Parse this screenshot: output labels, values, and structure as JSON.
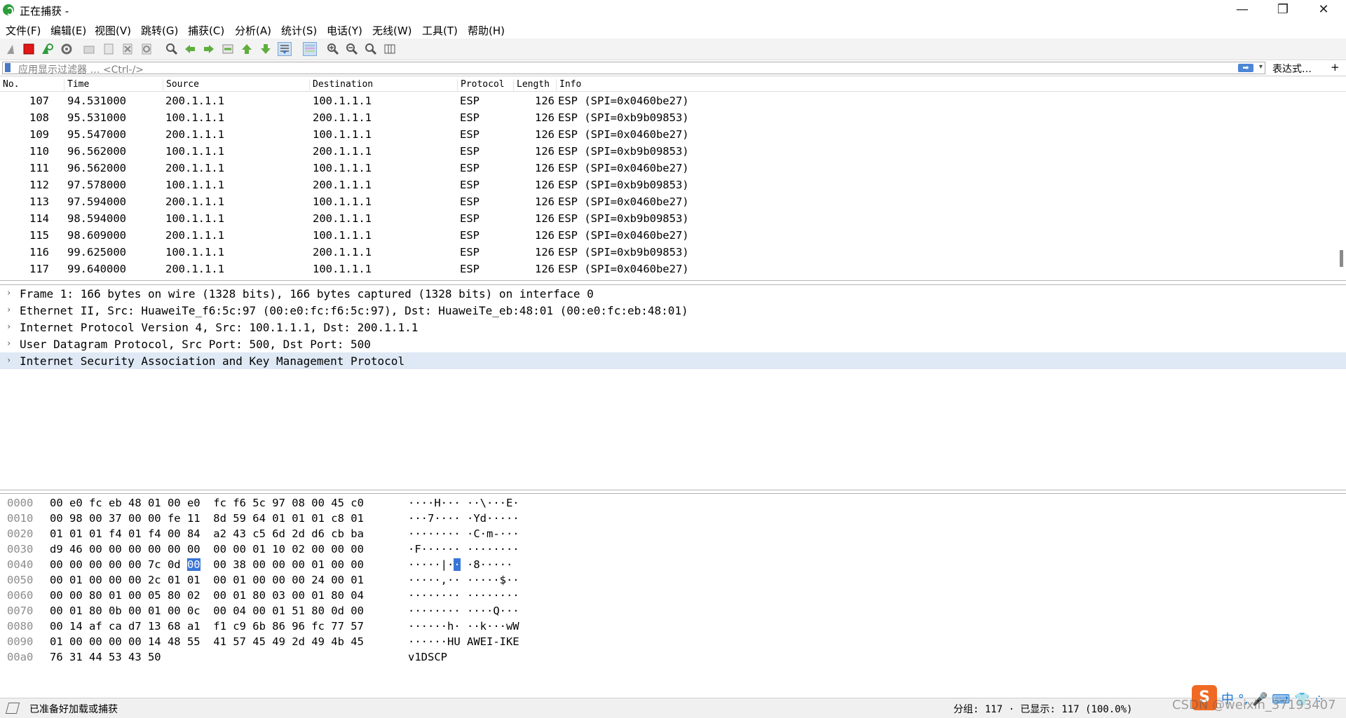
{
  "window": {
    "title": "正在捕获 -",
    "controls": [
      "—",
      "❐",
      "✕"
    ]
  },
  "menu": [
    "文件(F)",
    "编辑(E)",
    "视图(V)",
    "跳转(G)",
    "捕获(C)",
    "分析(A)",
    "统计(S)",
    "电话(Y)",
    "无线(W)",
    "工具(T)",
    "帮助(H)"
  ],
  "filter": {
    "placeholder": "应用显示过滤器 … <Ctrl-/>",
    "apply_label": "➡",
    "dropdown": "▾",
    "expression_label": "表达式…",
    "add_label": "+"
  },
  "packet_list": {
    "columns": [
      "No.",
      "Time",
      "Source",
      "Destination",
      "Protocol",
      "Length",
      "Info"
    ],
    "rows": [
      {
        "no": "107",
        "time": "94.531000",
        "src": "200.1.1.1",
        "dst": "100.1.1.1",
        "proto": "ESP",
        "len": "126",
        "info": "ESP (SPI=0x0460be27)"
      },
      {
        "no": "108",
        "time": "95.531000",
        "src": "100.1.1.1",
        "dst": "200.1.1.1",
        "proto": "ESP",
        "len": "126",
        "info": "ESP (SPI=0xb9b09853)"
      },
      {
        "no": "109",
        "time": "95.547000",
        "src": "200.1.1.1",
        "dst": "100.1.1.1",
        "proto": "ESP",
        "len": "126",
        "info": "ESP (SPI=0x0460be27)"
      },
      {
        "no": "110",
        "time": "96.562000",
        "src": "100.1.1.1",
        "dst": "200.1.1.1",
        "proto": "ESP",
        "len": "126",
        "info": "ESP (SPI=0xb9b09853)"
      },
      {
        "no": "111",
        "time": "96.562000",
        "src": "200.1.1.1",
        "dst": "100.1.1.1",
        "proto": "ESP",
        "len": "126",
        "info": "ESP (SPI=0x0460be27)"
      },
      {
        "no": "112",
        "time": "97.578000",
        "src": "100.1.1.1",
        "dst": "200.1.1.1",
        "proto": "ESP",
        "len": "126",
        "info": "ESP (SPI=0xb9b09853)"
      },
      {
        "no": "113",
        "time": "97.594000",
        "src": "200.1.1.1",
        "dst": "100.1.1.1",
        "proto": "ESP",
        "len": "126",
        "info": "ESP (SPI=0x0460be27)"
      },
      {
        "no": "114",
        "time": "98.594000",
        "src": "100.1.1.1",
        "dst": "200.1.1.1",
        "proto": "ESP",
        "len": "126",
        "info": "ESP (SPI=0xb9b09853)"
      },
      {
        "no": "115",
        "time": "98.609000",
        "src": "200.1.1.1",
        "dst": "100.1.1.1",
        "proto": "ESP",
        "len": "126",
        "info": "ESP (SPI=0x0460be27)"
      },
      {
        "no": "116",
        "time": "99.625000",
        "src": "100.1.1.1",
        "dst": "200.1.1.1",
        "proto": "ESP",
        "len": "126",
        "info": "ESP (SPI=0xb9b09853)"
      },
      {
        "no": "117",
        "time": "99.640000",
        "src": "200.1.1.1",
        "dst": "100.1.1.1",
        "proto": "ESP",
        "len": "126",
        "info": "ESP (SPI=0x0460be27)"
      }
    ]
  },
  "details": [
    "Frame 1: 166 bytes on wire (1328 bits), 166 bytes captured (1328 bits) on interface 0",
    "Ethernet II, Src: HuaweiTe_f6:5c:97 (00:e0:fc:f6:5c:97), Dst: HuaweiTe_eb:48:01 (00:e0:fc:eb:48:01)",
    "Internet Protocol Version 4, Src: 100.1.1.1, Dst: 200.1.1.1",
    "User Datagram Protocol, Src Port: 500, Dst Port: 500",
    "Internet Security Association and Key Management Protocol"
  ],
  "hex_dump": [
    {
      "offset": "0000",
      "hex": "00 e0 fc eb 48 01 00 e0  fc f6 5c 97 08 00 45 c0",
      "ascii": "····H··· ··\\···E·"
    },
    {
      "offset": "0010",
      "hex": "00 98 00 37 00 00 fe 11  8d 59 64 01 01 01 c8 01",
      "ascii": "···7···· ·Yd·····"
    },
    {
      "offset": "0020",
      "hex": "01 01 01 f4 01 f4 00 84  a2 43 c5 6d 2d d6 cb ba",
      "ascii": "········ ·C·m-···"
    },
    {
      "offset": "0030",
      "hex": "d9 46 00 00 00 00 00 00  00 00 01 10 02 00 00 00",
      "ascii": "·F······ ········"
    },
    {
      "offset": "0040",
      "hex_before": "00 00 00 00 00 7c 0d ",
      "hex_sel": "00",
      "hex_after": "  00 38 00 00 00 01 00 00",
      "ascii_before": "·····|·",
      "ascii_sel": "·",
      "ascii_after": " ·8·····"
    },
    {
      "offset": "0050",
      "hex": "00 01 00 00 00 2c 01 01  00 01 00 00 00 24 00 01",
      "ascii": "·····,·· ·····$··"
    },
    {
      "offset": "0060",
      "hex": "00 00 80 01 00 05 80 02  00 01 80 03 00 01 80 04",
      "ascii": "········ ········"
    },
    {
      "offset": "0070",
      "hex": "00 01 80 0b 00 01 00 0c  00 04 00 01 51 80 0d 00",
      "ascii": "········ ····Q···"
    },
    {
      "offset": "0080",
      "hex": "00 14 af ca d7 13 68 a1  f1 c9 6b 86 96 fc 77 57",
      "ascii": "······h· ··k···wW"
    },
    {
      "offset": "0090",
      "hex": "01 00 00 00 00 14 48 55  41 57 45 49 2d 49 4b 45",
      "ascii": "······HU AWEI-IKE"
    },
    {
      "offset": "00a0",
      "hex": "76 31 44 53 43 50",
      "ascii": "v1DSCP"
    }
  ],
  "status": {
    "left": "已准备好加载或捕获",
    "right": "分组: 117 · 已显示: 117 (100.0%)"
  },
  "overlay": {
    "watermark": "CSDN @weixin_37193407",
    "ime_logo": "S",
    "ime_items": "中 °, 🎤 ⌨ 👕 ⁘"
  },
  "colors": {
    "selected_row_bg": "#dfe9f5",
    "byte_highlight": "#3875d7",
    "app_icon": "#2e9d3c"
  }
}
